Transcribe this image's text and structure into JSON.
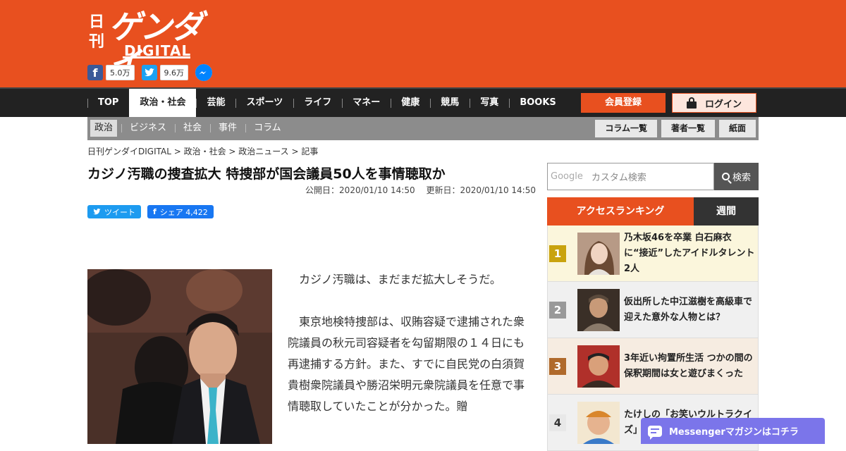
{
  "header": {
    "logo": {
      "small": "日刊",
      "main": "ゲンダイ",
      "sub": "DIGITAL"
    },
    "share": {
      "facebook_count": "5.0万",
      "twitter_count": "9.6万"
    }
  },
  "mainnav": {
    "items": [
      "TOP",
      "政治・社会",
      "芸能",
      "スポーツ",
      "ライフ",
      "マネー",
      "健康",
      "競馬",
      "写真",
      "BOOKS"
    ],
    "register": "会員登録",
    "login": "ログイン"
  },
  "subnav": {
    "items": [
      "政治",
      "ビジネス",
      "社会",
      "事件",
      "コラム"
    ],
    "buttons": [
      "コラム一覧",
      "著者一覧",
      "紙面"
    ]
  },
  "breadcrumb": "日刊ゲンダイDIGITAL > 政治・社会 > 政治ニュース > 記事",
  "article": {
    "title": "カジノ汚職の捜査拡大 特捜部が国会議員50人を事情聴取か",
    "published": "公開日：2020/01/10 14:50",
    "updated": "更新日：2020/01/10 14:50",
    "tweet_label": "ツイート",
    "share_label": "シェア 4,422",
    "paragraphs": [
      "カジノ汚職は、まだまだ拡大しそうだ。",
      "東京地検特捜部は、収賄容疑で逮捕された衆院議員の秋元司容疑者を勾留期限の１４日にも再逮捕する方針。また、すでに自民党の白須賀貴樹衆院議員や勝沼栄明元衆院議員を任意で事情聴取していたことが分かった。贈"
    ]
  },
  "search": {
    "brand": "Google",
    "placeholder": "カスタム検索",
    "button": "検索"
  },
  "ranking": {
    "tab_access": "アクセスランキング",
    "tab_week": "週間",
    "items": [
      {
        "rank": "1",
        "text": "乃木坂46を卒業 白石麻衣に“接近”したアイドルタレント2人"
      },
      {
        "rank": "2",
        "text": "仮出所した中江滋樹を高級車で迎えた意外な人物とは？"
      },
      {
        "rank": "3",
        "text": "3年近い拘置所生活 つかの間の保釈期間は女と遊びまくった"
      },
      {
        "rank": "4",
        "text": "たけしの「お笑いウルトラクイズ」"
      }
    ]
  },
  "messenger_banner": "Messengerマガジンはコチラ",
  "colors": {
    "brand": "#e8501f",
    "nav": "#222222",
    "subnav": "#8c8c8c",
    "messenger": "#7b75ea"
  }
}
